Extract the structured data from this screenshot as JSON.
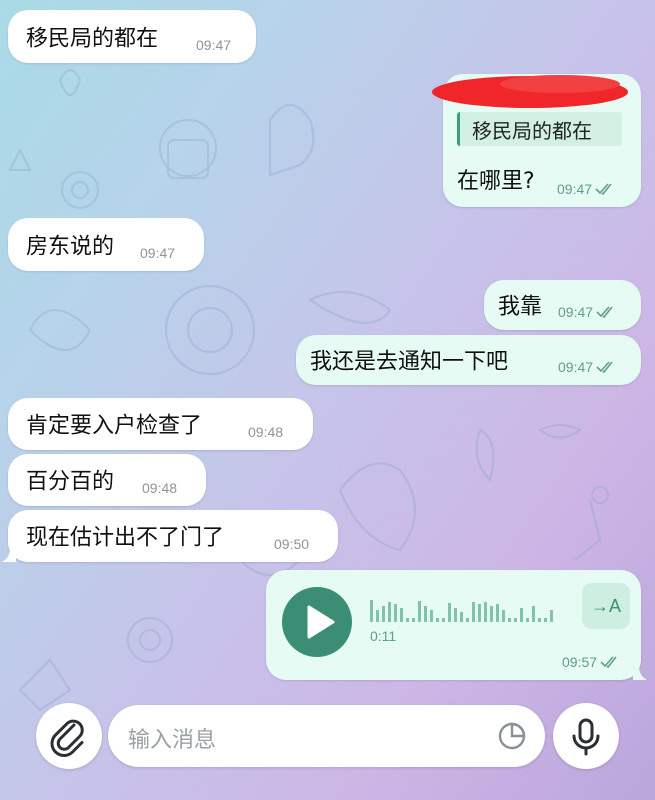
{
  "messages": [
    {
      "id": "m1",
      "side": "in",
      "text": "移民局的都在",
      "time": "09:47"
    },
    {
      "id": "m2",
      "side": "out",
      "reply_quote": "移民局的都在",
      "text": "在哪里?",
      "time": "09:47",
      "read": true
    },
    {
      "id": "m3",
      "side": "in",
      "text": "房东说的",
      "time": "09:47"
    },
    {
      "id": "m4",
      "side": "out",
      "text": "我靠",
      "time": "09:47",
      "read": true
    },
    {
      "id": "m5",
      "side": "out",
      "text": "我还是去通知一下吧",
      "time": "09:47",
      "read": true
    },
    {
      "id": "m6",
      "side": "in",
      "text": "肯定要入户检查了",
      "time": "09:48"
    },
    {
      "id": "m7",
      "side": "in",
      "text": "百分百的",
      "time": "09:48"
    },
    {
      "id": "m8",
      "side": "in",
      "text": "现在估计出不了门了",
      "time": "09:50"
    }
  ],
  "voice_message": {
    "duration": "0:11",
    "time": "09:57",
    "transcribe_label": "→A",
    "read": true
  },
  "composer": {
    "placeholder": "输入消息"
  },
  "colors": {
    "incoming_bubble": "#ffffff",
    "outgoing_bubble": "#e6fbf3",
    "accent": "#3b8e74",
    "redaction": "#f0262a"
  },
  "icons": [
    "paperclip-icon",
    "sticker-icon",
    "microphone-icon",
    "play-icon",
    "read-receipt-icon"
  ]
}
